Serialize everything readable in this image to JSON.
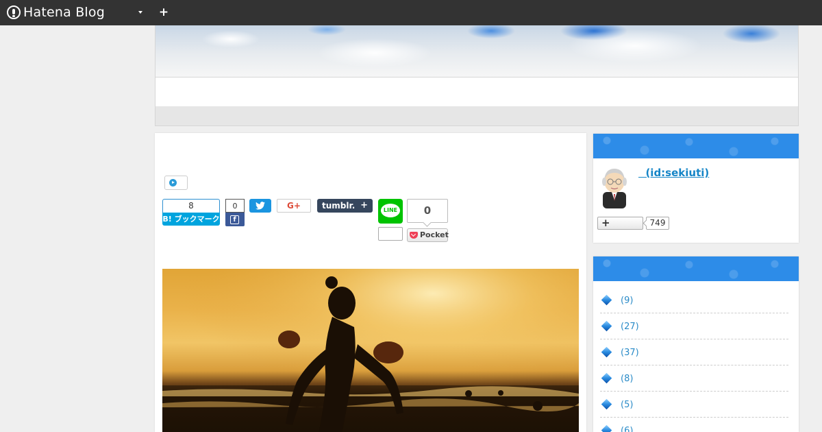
{
  "topbar": {
    "brand": "Hatena Blog",
    "dropdown_icon": "caret-down-icon",
    "add_icon": "plus-icon"
  },
  "article": {
    "share": {
      "hatena_bookmark_count": "8",
      "hatena_bookmark_label": "B! ブックマーク",
      "facebook_count": "0",
      "facebook_icon": "f",
      "twitter_icon": "bird-icon",
      "googleplus_label": "G+",
      "tumblr_label": "tumblr.",
      "tumblr_plus": "+",
      "line_label": "LINE",
      "line_count": "",
      "pocket_count": "0",
      "pocket_label": "Pocket"
    }
  },
  "sidebar": {
    "profile": {
      "id_link": "  (id:sekiuti)",
      "follow_icon": "+",
      "follower_count": "749"
    },
    "categories": {
      "items": [
        {
          "count": "(9)"
        },
        {
          "count": "(27)"
        },
        {
          "count": "(37)"
        },
        {
          "count": "(8)"
        },
        {
          "count": "(5)"
        },
        {
          "count": "(6)"
        }
      ]
    }
  },
  "colors": {
    "topbar": "#333333",
    "accent_blue": "#2d8ce8",
    "hatena_blue": "#00a4de",
    "facebook": "#3b5998",
    "twitter": "#1b95e0",
    "tumblr": "#36465d",
    "line": "#00c300",
    "pocket": "#ee4056"
  }
}
